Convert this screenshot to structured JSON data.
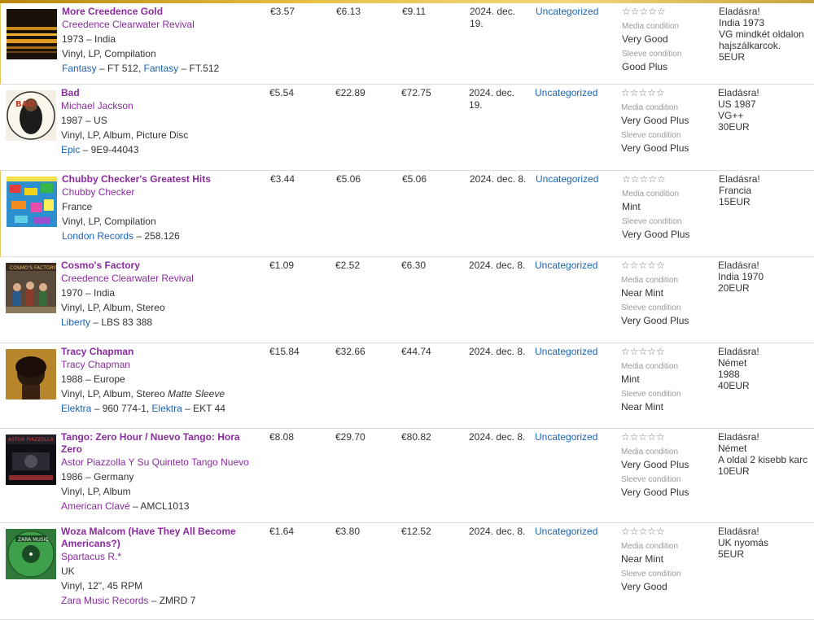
{
  "rows": [
    {
      "title": "More Creedence Gold",
      "artist": "Creedence Clearwater Revival",
      "year_country": "1973 – India",
      "format": "Vinyl, LP, Compilation",
      "format_extra": "",
      "labels": [
        {
          "name": "Fantasy",
          "cat": " – FT 512, "
        },
        {
          "name": "Fantasy",
          "cat": " – FT.512"
        }
      ],
      "min": "€3.57",
      "med": "€6.13",
      "max": "€9.11",
      "date": "2024. dec. 19.",
      "folder": "Uncategorized",
      "stars": "☆☆☆☆☆",
      "media_label": "Media condition",
      "media": "Very Good",
      "sleeve_label": "Sleeve condition",
      "sleeve": "Good Plus",
      "notes": [
        "Eladásra!",
        "India 1973",
        "VG mindkét oldalon hajszálkarcok.",
        "5EUR"
      ]
    },
    {
      "title": "Bad",
      "artist": "Michael Jackson",
      "year_country": "1987 – US",
      "format": "Vinyl, LP, Album, Picture Disc",
      "format_extra": "",
      "labels": [
        {
          "name": "Epic",
          "cat": " – 9E9-44043"
        }
      ],
      "min": "€5.54",
      "med": "€22.89",
      "max": "€72.75",
      "date": "2024. dec. 19.",
      "folder": "Uncategorized",
      "stars": "☆☆☆☆☆",
      "media_label": "Media condition",
      "media": "Very Good Plus",
      "sleeve_label": "Sleeve condition",
      "sleeve": "Very Good Plus",
      "notes": [
        "Eladásra!",
        "US 1987",
        "VG++",
        "30EUR"
      ]
    },
    {
      "title": "Chubby Checker's Greatest Hits",
      "artist": "Chubby Checker",
      "year_country": "France",
      "format": "Vinyl, LP, Compilation",
      "format_extra": "",
      "labels": [
        {
          "name": "London Records",
          "cat": " – 258.126"
        }
      ],
      "min": "€3.44",
      "med": "€5.06",
      "max": "€5.06",
      "date": "2024. dec. 8.",
      "folder": "Uncategorized",
      "stars": "☆☆☆☆☆",
      "media_label": "Media condition",
      "media": "Mint",
      "sleeve_label": "Sleeve condition",
      "sleeve": "Very Good Plus",
      "notes": [
        "Eladásra!",
        "Francia",
        "15EUR"
      ]
    },
    {
      "title": "Cosmo's Factory",
      "artist": "Creedence Clearwater Revival",
      "year_country": "1970 – India",
      "format": "Vinyl, LP, Album, Stereo",
      "format_extra": "",
      "labels": [
        {
          "name": "Liberty",
          "cat": " – LBS 83 388"
        }
      ],
      "min": "€1.09",
      "med": "€2.52",
      "max": "€6.30",
      "date": "2024. dec. 8.",
      "folder": "Uncategorized",
      "stars": "☆☆☆☆☆",
      "media_label": "Media condition",
      "media": "Near Mint",
      "sleeve_label": "Sleeve condition",
      "sleeve": "Very Good Plus",
      "notes": [
        "Eladásra!",
        "India 1970",
        "20EUR"
      ]
    },
    {
      "title": "Tracy Chapman",
      "artist": "Tracy Chapman",
      "year_country": "1988 – Europe",
      "format": "Vinyl, LP, Album, Stereo ",
      "format_extra": "Matte Sleeve",
      "labels": [
        {
          "name": "Elektra",
          "cat": " – 960 774-1, "
        },
        {
          "name": "Elektra",
          "cat": " – EKT 44"
        }
      ],
      "min": "€15.84",
      "med": "€32.66",
      "max": "€44.74",
      "date": "2024. dec. 8.",
      "folder": "Uncategorized",
      "stars": "☆☆☆☆☆",
      "media_label": "Media condition",
      "media": "Mint",
      "sleeve_label": "Sleeve condition",
      "sleeve": "Near Mint",
      "notes": [
        "Eladásra!",
        "Német",
        "1988",
        "40EUR"
      ]
    },
    {
      "title": "Tango: Zero Hour / Nuevo Tango: Hora Zero",
      "artist": "Astor Piazzolla Y Su Quinteto Tango Nuevo",
      "year_country": "1986 – Germany",
      "format": "Vinyl, LP, Album",
      "format_extra": "",
      "labels": [
        {
          "name": "American Clavé",
          "cat": " – AMCL1013"
        }
      ],
      "min": "€8.08",
      "med": "€29.70",
      "max": "€80.82",
      "date": "2024. dec. 8.",
      "folder": "Uncategorized",
      "stars": "☆☆☆☆☆",
      "media_label": "Media condition",
      "media": "Very Good Plus",
      "sleeve_label": "Sleeve condition",
      "sleeve": "Very Good Plus",
      "notes": [
        "Eladásra!",
        "Német",
        "A oldal 2 kisebb karc",
        "10EUR"
      ]
    },
    {
      "title": "Woza Malcom (Have They All Become Americans?)",
      "artist": "Spartacus R.*",
      "year_country": "UK",
      "format": "Vinyl, 12\", 45 RPM",
      "format_extra": "",
      "labels": [
        {
          "name": "Zara Music Records",
          "cat": " – ZMRD 7"
        }
      ],
      "min": "€1.64",
      "med": "€3.80",
      "max": "€12.52",
      "date": "2024. dec. 8.",
      "folder": "Uncategorized",
      "stars": "☆☆☆☆☆",
      "media_label": "Media condition",
      "media": "Near Mint",
      "sleeve_label": "Sleeve condition",
      "sleeve": "Very Good",
      "notes": [
        "Eladásra!",
        "UK nyomás",
        "5EUR"
      ]
    }
  ]
}
